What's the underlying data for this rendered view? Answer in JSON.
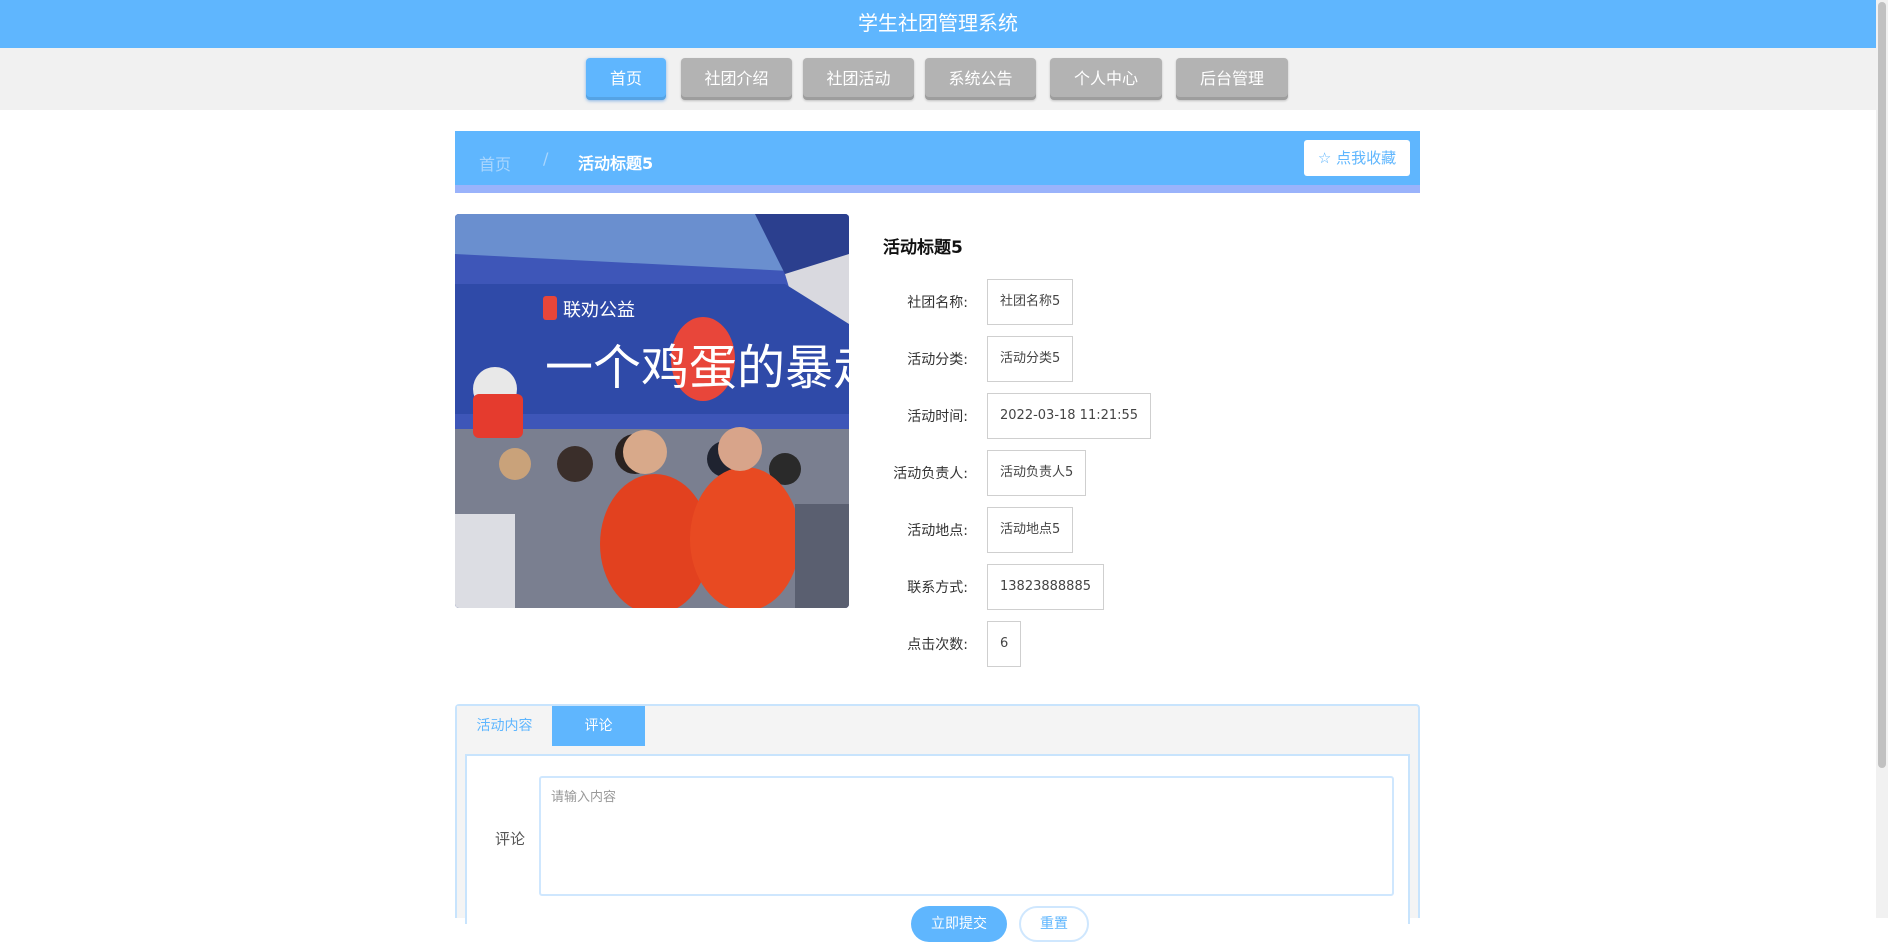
{
  "header": {
    "title": "学生社团管理系统"
  },
  "nav": {
    "items": [
      {
        "label": "首页"
      },
      {
        "label": "社团介绍"
      },
      {
        "label": "社团活动"
      },
      {
        "label": "系统公告"
      },
      {
        "label": "个人中心"
      },
      {
        "label": "后台管理"
      }
    ],
    "active": "首页"
  },
  "breadcrumb": {
    "home": "首页",
    "separator": "/",
    "current": "活动标题5"
  },
  "favorite_button": {
    "label": "点我收藏",
    "icon": "star-outline-icon"
  },
  "photo": {
    "logo_text": "联劝公益",
    "banner_text": "一个鸡蛋的暴走"
  },
  "detail": {
    "title": "活动标题5",
    "fields": [
      {
        "label": "社团名称:",
        "value": "社团名称5"
      },
      {
        "label": "活动分类:",
        "value": "活动分类5"
      },
      {
        "label": "活动时间:",
        "value": "2022-03-18 11:21:55"
      },
      {
        "label": "活动负责人:",
        "value": "活动负责人5"
      },
      {
        "label": "活动地点:",
        "value": "活动地点5"
      },
      {
        "label": "联系方式:",
        "value": "13823888885"
      },
      {
        "label": "点击次数:",
        "value": "6"
      }
    ]
  },
  "tabs": {
    "items": [
      {
        "label": "活动内容"
      },
      {
        "label": "评论"
      }
    ],
    "active": "评论"
  },
  "comment": {
    "label": "评论",
    "placeholder": "请输入内容",
    "value": "",
    "submit_label": "立即提交",
    "reset_label": "重置"
  },
  "colors": {
    "primary": "#5fb6fe",
    "nav_inactive": "#b3b3b3"
  }
}
